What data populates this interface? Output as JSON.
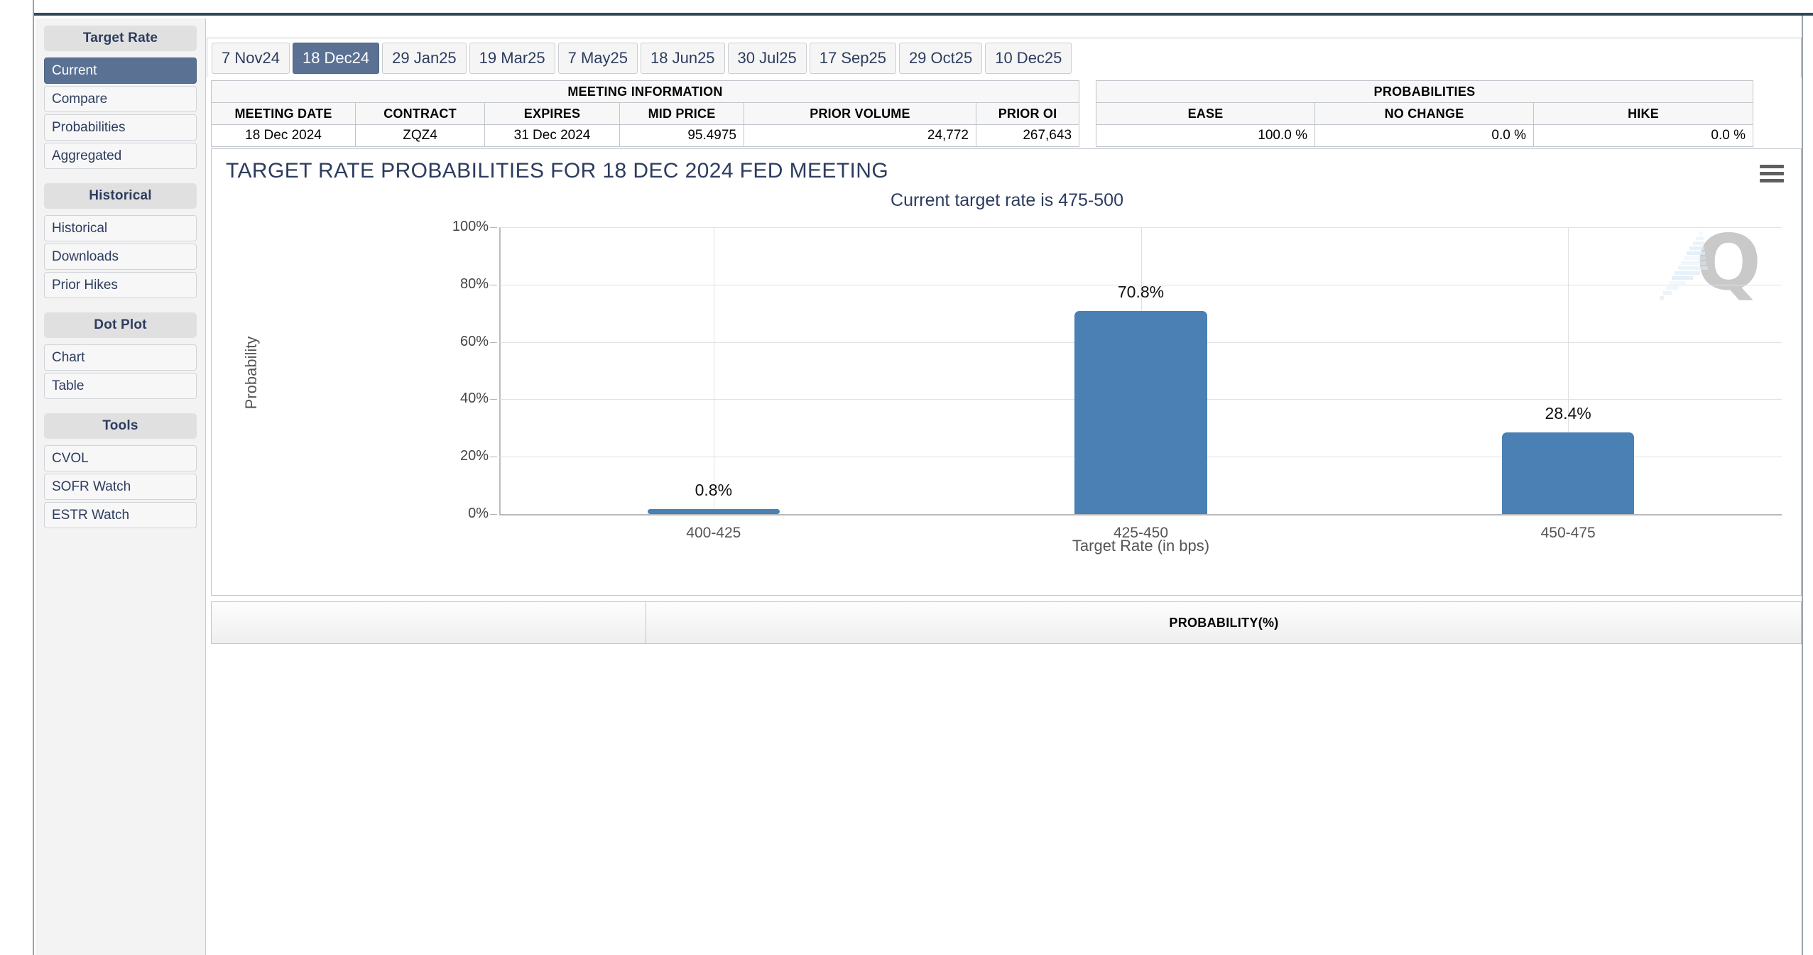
{
  "sidebar": {
    "groups": [
      {
        "header": "Target Rate",
        "items": [
          {
            "label": "Current",
            "active": true
          },
          {
            "label": "Compare",
            "active": false
          },
          {
            "label": "Probabilities",
            "active": false
          },
          {
            "label": "Aggregated",
            "active": false
          }
        ]
      },
      {
        "header": "Historical",
        "items": [
          {
            "label": "Historical",
            "active": false
          },
          {
            "label": "Downloads",
            "active": false
          },
          {
            "label": "Prior Hikes",
            "active": false
          }
        ]
      },
      {
        "header": "Dot Plot",
        "items": [
          {
            "label": "Chart",
            "active": false
          },
          {
            "label": "Table",
            "active": false
          }
        ]
      },
      {
        "header": "Tools",
        "items": [
          {
            "label": "CVOL",
            "active": false
          },
          {
            "label": "SOFR Watch",
            "active": false
          },
          {
            "label": "ESTR Watch",
            "active": false
          }
        ]
      }
    ]
  },
  "tabs": [
    {
      "label": "7 Nov24",
      "active": false
    },
    {
      "label": "18 Dec24",
      "active": true
    },
    {
      "label": "29 Jan25",
      "active": false
    },
    {
      "label": "19 Mar25",
      "active": false
    },
    {
      "label": "7 May25",
      "active": false
    },
    {
      "label": "18 Jun25",
      "active": false
    },
    {
      "label": "30 Jul25",
      "active": false
    },
    {
      "label": "17 Sep25",
      "active": false
    },
    {
      "label": "29 Oct25",
      "active": false
    },
    {
      "label": "10 Dec25",
      "active": false
    }
  ],
  "meeting_information": {
    "banner": "MEETING INFORMATION",
    "headers": [
      "MEETING DATE",
      "CONTRACT",
      "EXPIRES",
      "MID PRICE",
      "PRIOR VOLUME",
      "PRIOR OI"
    ],
    "row": [
      "18 Dec 2024",
      "ZQZ4",
      "31 Dec 2024",
      "95.4975",
      "24,772",
      "267,643"
    ]
  },
  "probabilities_table": {
    "banner": "PROBABILITIES",
    "headers": [
      "EASE",
      "NO CHANGE",
      "HIKE"
    ],
    "row": [
      "100.0 %",
      "0.0 %",
      "0.0 %"
    ]
  },
  "chart_panel": {
    "menu_icon": "hamburger-menu-icon",
    "watermark": "Q"
  },
  "bottom_table": {
    "left_cell": "",
    "probability_header": "PROBABILITY(%)"
  },
  "colors": {
    "bar": "#4a80b4",
    "accent": "#5a7194",
    "title": "#2d3c5e"
  },
  "chart_data": {
    "type": "bar",
    "title": "TARGET RATE PROBABILITIES FOR 18 DEC 2024 FED MEETING",
    "subtitle": "Current target rate is 475-500",
    "xlabel": "Target Rate (in bps)",
    "ylabel": "Probability",
    "categories": [
      "400-425",
      "425-450",
      "450-475"
    ],
    "values": [
      0.8,
      70.8,
      28.4
    ],
    "data_labels": [
      "0.8%",
      "70.8%",
      "28.4%"
    ],
    "ylim": [
      0,
      100
    ],
    "yticks": [
      0,
      20,
      40,
      60,
      80,
      100
    ],
    "ytick_labels": [
      "0%",
      "20%",
      "40%",
      "60%",
      "80%",
      "100%"
    ],
    "grid": true,
    "legend": false,
    "series_color": "#4a80b4"
  }
}
